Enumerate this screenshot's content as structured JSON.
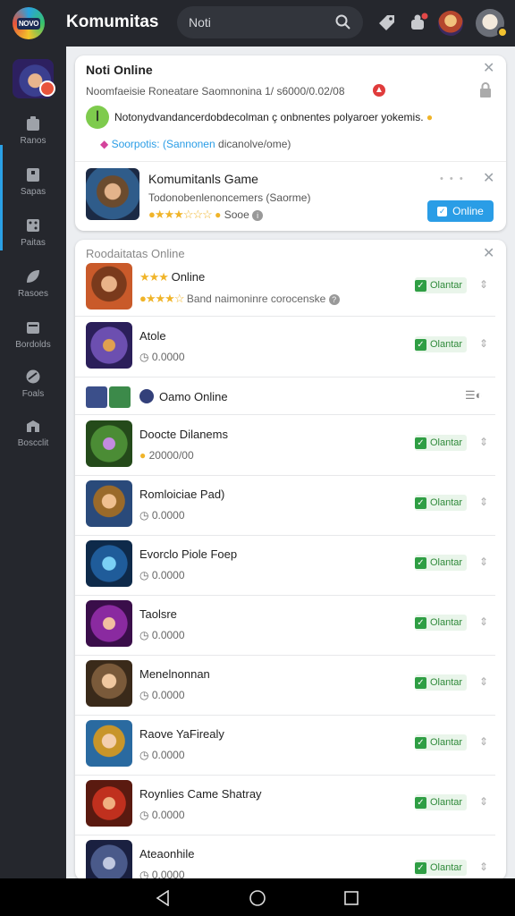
{
  "topbar": {
    "logo_text": "NOVO",
    "title": "Komumitas",
    "search_text": "Noti"
  },
  "sidebar": {
    "items": [
      {
        "label": "Ranos"
      },
      {
        "label": "Sapas"
      },
      {
        "label": "Paitas"
      },
      {
        "label": "Rasoes"
      },
      {
        "label": "Bordolds"
      },
      {
        "label": "Foals"
      },
      {
        "label": "Boscclit"
      }
    ]
  },
  "notif": {
    "title": "Noti Online",
    "subtitle": "Noomfaeisie Roneatare Saomnonina 1/ s6000/0.02/08",
    "message": "Notonydvandancerdobdecolman ç onbnentes polyaroer yokemis.",
    "tag_text_a": "Soorpotis: (Sannonen",
    "tag_text_b": "dicanolve/ome)",
    "game_title": "Komumitanls Game",
    "game_desc": "Todonobenlenoncemers (Saorme)",
    "game_rating_label": "Sooe",
    "online_button": "Online",
    "dots": "• • •"
  },
  "list": {
    "header": "Roodaitatas Online",
    "first": {
      "title": "Online",
      "sub": "Band  naimoninre corocenske"
    },
    "group_label": "Oamo Online",
    "status_label": "Olantar",
    "rows": [
      {
        "title": "Atole",
        "sub": "0.0000"
      },
      {
        "title": "Doocte Dilanems",
        "sub": "20000/00"
      },
      {
        "title": "Romloiciae Pad)",
        "sub": "0.0000"
      },
      {
        "title": "Evorclo Piole Foep",
        "sub": "0.0000"
      },
      {
        "title": "Taolsre",
        "sub": "0.0000"
      },
      {
        "title": "Menelnonnan",
        "sub": "0.0000"
      },
      {
        "title": "Raove YaFirealy",
        "sub": "0.0000"
      },
      {
        "title": "Roynlies Came Shatray",
        "sub": "0.0000"
      },
      {
        "title": "Ateaonhile",
        "sub": "0.0000"
      }
    ]
  },
  "colors": {
    "accent": "#2a9de6",
    "online_green": "#2f9e44",
    "star": "#f0b429"
  }
}
